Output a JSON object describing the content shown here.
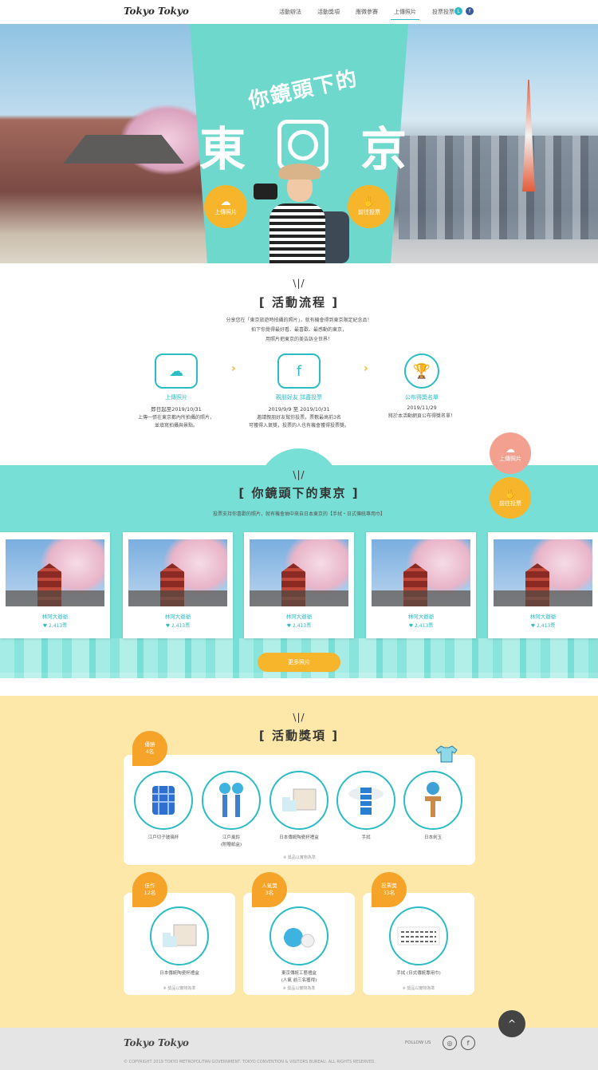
{
  "header": {
    "logo": "Tokyo Tokyo",
    "nav": [
      "活動辦法",
      "活動獎項",
      "應徵參賽",
      "上傳照片",
      "投票投票"
    ],
    "active_index": 3,
    "social": [
      "line-icon",
      "facebook-icon"
    ]
  },
  "hero": {
    "title_small": "你鏡頭下的",
    "title_chars": [
      "東",
      "京"
    ],
    "btn_upload": "上傳照片",
    "btn_vote": "前往投票"
  },
  "process": {
    "title": "[ 活動流程 ]",
    "desc_lines": [
      "分享您在「東京旅遊時拍攝的照片」，就有機會得到東京限定紀念品！",
      "拍下你覺得最好看、最喜歡、最感動的東京，",
      "用照片把東京的美告訴全世界！"
    ],
    "desc_highlight": "東京旅遊時拍攝的照片",
    "steps": [
      {
        "icon": "cloud-upload-icon",
        "title": "上傳照片",
        "date": "即日起至2019/10/31",
        "desc": [
          "上傳一張在東京都內所拍攝的照片，",
          "並填寫拍攝與景點。"
        ]
      },
      {
        "icon": "facebook-vote-icon",
        "title": "親朋好友 詳盡投票",
        "date": "2019/9/9 至 2019/10/31",
        "desc": [
          "邀請親朋好友幫你投票，票數最高前3名",
          "可獲得入氣獎，投票的人也有機會獲得投票獎。"
        ]
      },
      {
        "icon": "trophy-icon",
        "title": "公布得獎名單",
        "date": "2019/11/29",
        "desc": [
          "將於本活動網頁公布得獎名單！"
        ]
      }
    ]
  },
  "float_buttons": {
    "upload": "上傳照片",
    "vote": "前往投票"
  },
  "gallery": {
    "title": "[ 你鏡頭下的東京 ]",
    "desc": "投票支持你喜歡的照片，就有機會抽中來自日本東京的【手拭・日式傳統專用巾】",
    "cards": [
      {
        "name": "林阿大爺爺",
        "votes": "♥ 2,413票"
      },
      {
        "name": "林阿大爺爺",
        "votes": "♥ 2,413票"
      },
      {
        "name": "林阿大爺爺",
        "votes": "♥ 2,413票"
      },
      {
        "name": "林阿大爺爺",
        "votes": "♥ 2,413票"
      },
      {
        "name": "林阿大爺爺",
        "votes": "♥ 2,413票"
      }
    ],
    "more_button": "更多照片"
  },
  "prizes": {
    "title": "[ 活動獎項 ]",
    "grand": {
      "badge": [
        "優勝",
        "4名"
      ],
      "items": [
        {
          "name": [
            "江戶切子玻璃杯"
          ]
        },
        {
          "name": [
            "江戶風鈴",
            "(附贈紙盒)"
          ]
        },
        {
          "name": [
            "日本傳統陶瓷杯禮盒"
          ]
        },
        {
          "name": [
            "手拭"
          ]
        },
        {
          "name": [
            "日本劍玉"
          ]
        }
      ],
      "note": "※ 獎品以實物為準"
    },
    "small": [
      {
        "badge": [
          "佳作",
          "12名"
        ],
        "item": [
          "日本傳統陶瓷杯禮盒"
        ],
        "note": "※ 獎品以實物為準"
      },
      {
        "badge": [
          "人氣獎",
          "3名"
        ],
        "item": [
          "東京傳統工藝禮盒",
          "(人氣 前三名獲得)"
        ],
        "note": "※ 獎品以實物為準"
      },
      {
        "badge": [
          "投票獎",
          "33名"
        ],
        "item": [
          "手拭 (日式傳統專用巾)"
        ],
        "note": "※ 獎品以實物為準"
      }
    ]
  },
  "footer": {
    "logo": "Tokyo Tokyo",
    "follow": "FOLLOW US",
    "icons": [
      "instagram-icon",
      "facebook-icon"
    ],
    "copyright": "© COPYRIGHT 2019 TOKYO METROPOLITAN GOVERNMENT. TOKYO CONVENTION & VISITORS BUREAU. ALL RIGHTS RESERVED."
  },
  "colors": {
    "teal": "#2bbcc4",
    "mint": "#77dfd5",
    "orange": "#f7b52c",
    "cream": "#fde8a9"
  }
}
